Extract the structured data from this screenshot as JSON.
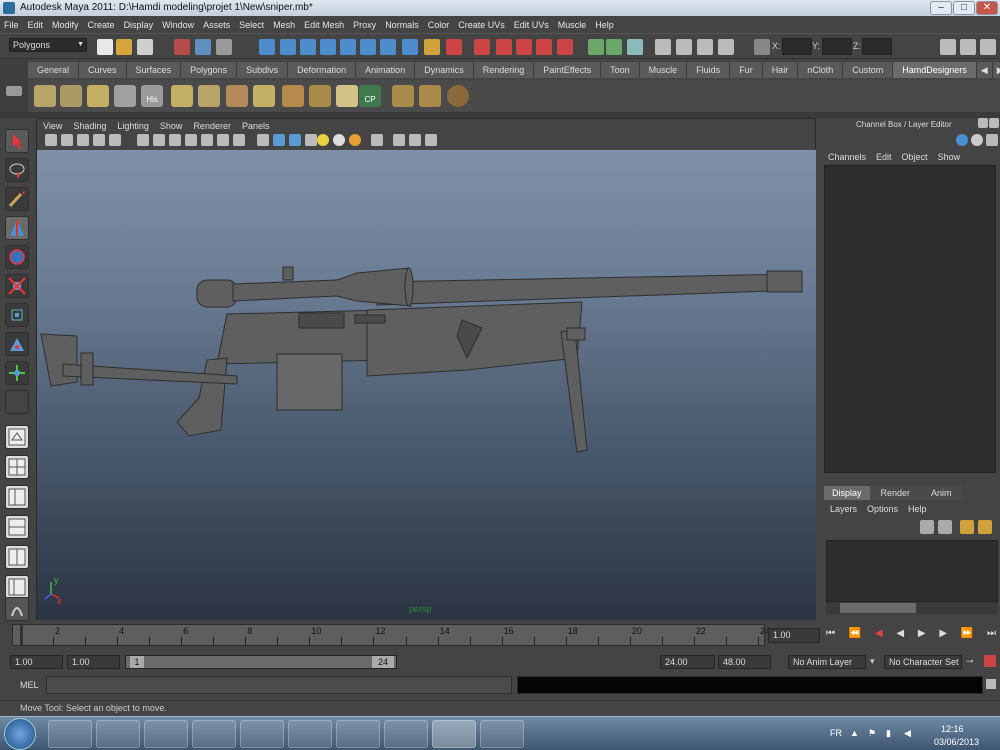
{
  "window": {
    "title": "Autodesk Maya 2011: D:\\Hamdi modeling\\projet 1\\New\\sniper.mb*"
  },
  "menubar": [
    "File",
    "Edit",
    "Modify",
    "Create",
    "Display",
    "Window",
    "Assets",
    "Select",
    "Mesh",
    "Edit Mesh",
    "Proxy",
    "Normals",
    "Color",
    "Create UVs",
    "Edit UVs",
    "Muscle",
    "Help"
  ],
  "status_line": {
    "mode": "Polygons",
    "x_label": "X:",
    "y_label": "Y:",
    "z_label": "Z:"
  },
  "shelf": {
    "tabs": [
      "General",
      "Curves",
      "Surfaces",
      "Polygons",
      "Subdivs",
      "Deformation",
      "Animation",
      "Dynamics",
      "Rendering",
      "PaintEffects",
      "Toon",
      "Muscle",
      "Fluids",
      "Fur",
      "Hair",
      "nCloth",
      "Custom",
      "HamdDesigners"
    ],
    "active_tab": "HamdDesigners",
    "icon_labels": {
      "his": "His",
      "cp": "CP"
    }
  },
  "viewport": {
    "menu": [
      "View",
      "Shading",
      "Lighting",
      "Show",
      "Renderer",
      "Panels"
    ],
    "camera_label": "persp",
    "axis_y": "y",
    "axis_x": "x"
  },
  "channel_box": {
    "title": "Channel Box / Layer Editor",
    "menu": [
      "Channels",
      "Edit",
      "Object",
      "Show"
    ]
  },
  "layer_editor": {
    "tabs": [
      "Display",
      "Render",
      "Anim"
    ],
    "active_tab": "Display",
    "menu": [
      "Layers",
      "Options",
      "Help"
    ]
  },
  "time_slider": {
    "ticks": [
      "2",
      "4",
      "6",
      "8",
      "10",
      "12",
      "14",
      "16",
      "18",
      "20",
      "22",
      "24"
    ],
    "current_time": "1.00"
  },
  "range_slider": {
    "start_time": "1.00",
    "playback_start": "1.00",
    "range_start": "1",
    "range_end": "24",
    "playback_end": "24.00",
    "end_time": "48.00",
    "anim_layer": "No Anim Layer",
    "character_set": "No Character Set"
  },
  "command_line": {
    "label": "MEL"
  },
  "help_line": {
    "text": "Move Tool: Select an object to move."
  },
  "taskbar": {
    "language": "FR",
    "time": "12:16",
    "date": "03/06/2013"
  },
  "colors": {
    "scene_top": "#7f90a8",
    "scene_bottom": "#2b3442",
    "model": "#5f5f5f"
  }
}
